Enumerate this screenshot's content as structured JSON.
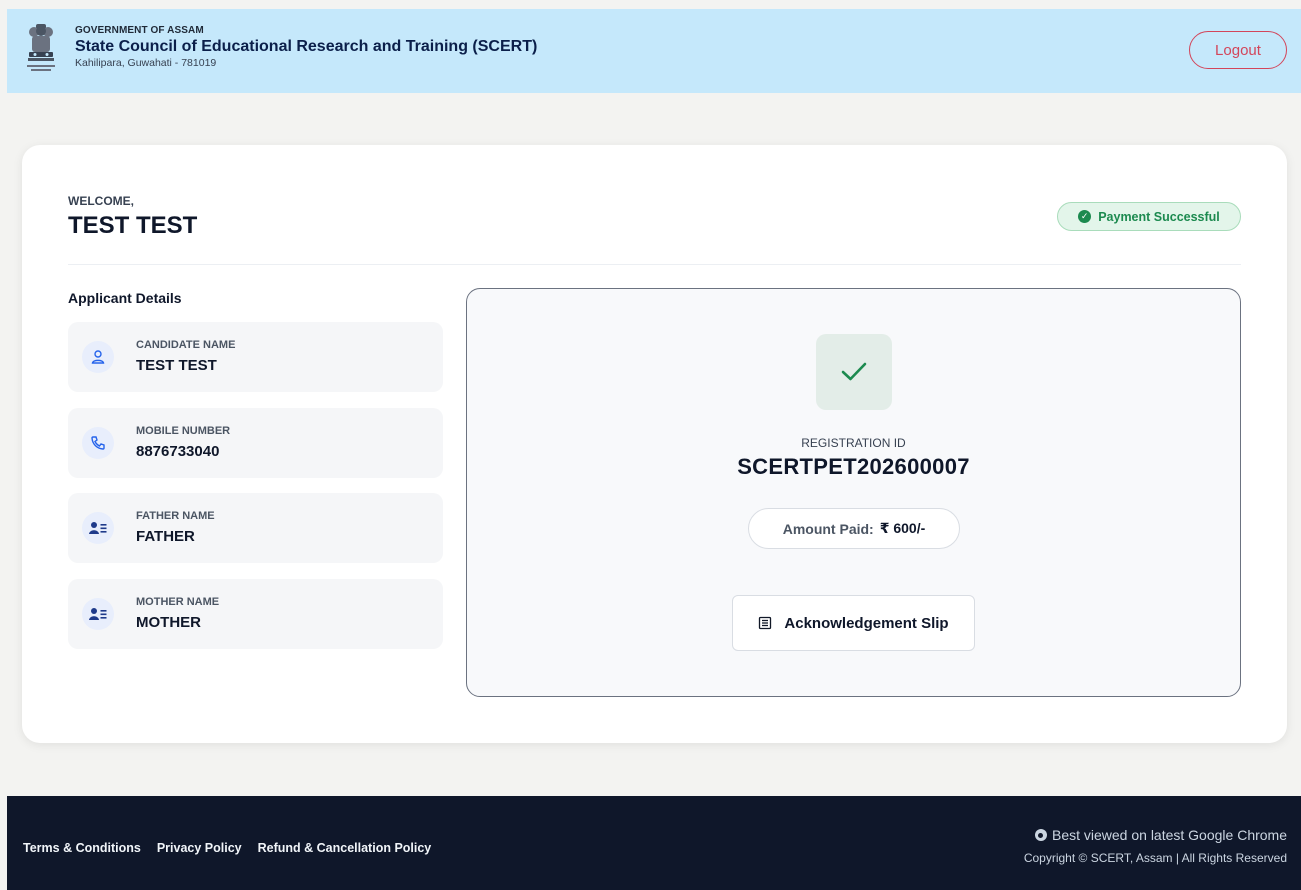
{
  "header": {
    "gov_label": "GOVERNMENT OF ASSAM",
    "title": "State Council of Educational Research and Training (SCERT)",
    "address": "Kahilipara, Guwahati - 781019",
    "logout_label": "Logout"
  },
  "welcome": {
    "label": "WELCOME,",
    "name": "TEST TEST",
    "status_badge": "Payment Successful"
  },
  "applicant": {
    "section_title": "Applicant Details",
    "items": [
      {
        "label": "CANDIDATE NAME",
        "value": "TEST TEST",
        "icon": "user-icon"
      },
      {
        "label": "MOBILE NUMBER",
        "value": "8876733040",
        "icon": "phone-icon"
      },
      {
        "label": "FATHER NAME",
        "value": "FATHER",
        "icon": "id-card-icon"
      },
      {
        "label": "MOTHER NAME",
        "value": "MOTHER",
        "icon": "id-card-icon"
      }
    ]
  },
  "registration": {
    "label": "REGISTRATION ID",
    "id": "SCERTPET202600007",
    "amount_label": "Amount Paid:",
    "amount_value": "₹ 600/-",
    "ack_button": "Acknowledgement Slip"
  },
  "footer": {
    "links": [
      "Terms & Conditions",
      "Privacy Policy",
      "Refund & Cancellation Policy"
    ],
    "browser_note": "Best viewed on latest Google Chrome",
    "copyright": "Copyright © SCERT, Assam | All Rights Reserved"
  },
  "colors": {
    "header_bg": "#c5e8fb",
    "logout": "#d3455a",
    "success": "#1c8a4f",
    "footer_bg": "#0f172a"
  }
}
